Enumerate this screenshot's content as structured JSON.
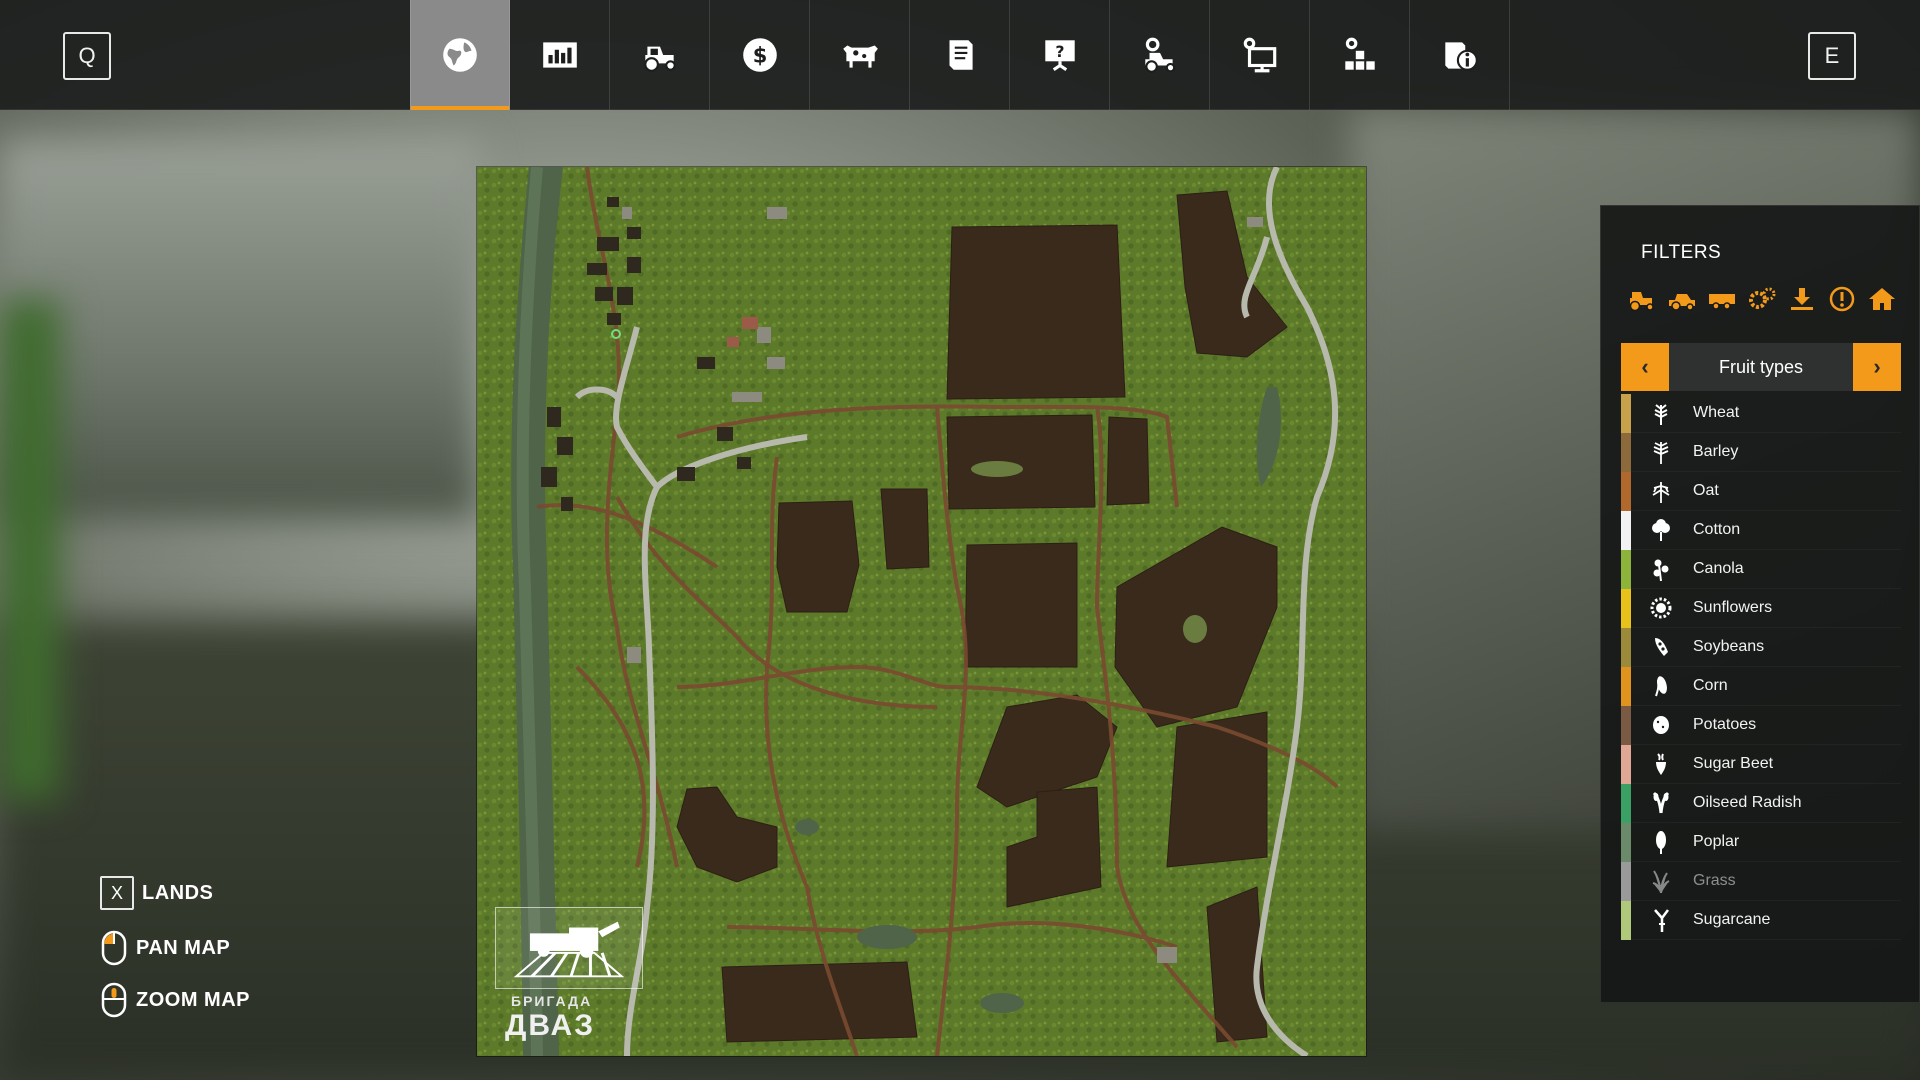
{
  "topbar": {
    "left_key": "Q",
    "right_key": "E",
    "tabs": [
      {
        "icon": "globe-icon",
        "active": true
      },
      {
        "icon": "statistics-icon",
        "active": false
      },
      {
        "icon": "tractor-icon",
        "active": false
      },
      {
        "icon": "money-icon",
        "active": false
      },
      {
        "icon": "cow-icon",
        "active": false
      },
      {
        "icon": "contracts-icon",
        "active": false
      },
      {
        "icon": "help-presentation-icon",
        "active": false
      },
      {
        "icon": "vehicle-settings-icon",
        "active": false
      },
      {
        "icon": "computer-settings-icon",
        "active": false
      },
      {
        "icon": "production-icon",
        "active": false
      },
      {
        "icon": "info-icon",
        "active": false
      }
    ]
  },
  "map": {
    "logo_line1": "БРИГАДА",
    "logo_line2": "ДВАЗ"
  },
  "controls": {
    "lands_key": "X",
    "lands_label": "LANDS",
    "pan_label": "PAN MAP",
    "zoom_label": "ZOOM MAP"
  },
  "filters": {
    "title": "FILTERS",
    "category_icons": [
      "tractor-icon",
      "harvester-icon",
      "trailer-icon",
      "tools-icon",
      "download-icon",
      "warning-icon",
      "home-icon"
    ],
    "selector_label": "Fruit types",
    "prev_arrow": "‹",
    "next_arrow": "›",
    "fruits": [
      {
        "name": "Wheat",
        "color": "#c8a24a",
        "icon": "wheat-icon"
      },
      {
        "name": "Barley",
        "color": "#8c6a3c",
        "icon": "barley-icon"
      },
      {
        "name": "Oat",
        "color": "#b0682c",
        "icon": "oat-icon"
      },
      {
        "name": "Cotton",
        "color": "#f2f2f2",
        "icon": "cotton-icon"
      },
      {
        "name": "Canola",
        "color": "#8cb43a",
        "icon": "canola-icon"
      },
      {
        "name": "Sunflowers",
        "color": "#e8c21a",
        "icon": "sunflower-icon"
      },
      {
        "name": "Soybeans",
        "color": "#9a8a3a",
        "icon": "soybean-icon"
      },
      {
        "name": "Corn",
        "color": "#e0941e",
        "icon": "corn-icon"
      },
      {
        "name": "Potatoes",
        "color": "#7a5a42",
        "icon": "potato-icon"
      },
      {
        "name": "Sugar Beet",
        "color": "#e0a894",
        "icon": "sugarbeet-icon"
      },
      {
        "name": "Oilseed Radish",
        "color": "#3aa064",
        "icon": "radish-icon"
      },
      {
        "name": "Poplar",
        "color": "#6a8a6a",
        "icon": "poplar-icon"
      },
      {
        "name": "Grass",
        "color": "#9a9a9a",
        "icon": "grass-icon",
        "dim": true
      },
      {
        "name": "Sugarcane",
        "color": "#b0c87a",
        "icon": "sugarcane-icon"
      }
    ]
  },
  "colors": {
    "accent": "#f39a1b",
    "panel_bg": "#181a19",
    "field_dark": "#3a2a1c",
    "grass_green": "#5e7a2a",
    "road_brown": "#7a4a30"
  }
}
